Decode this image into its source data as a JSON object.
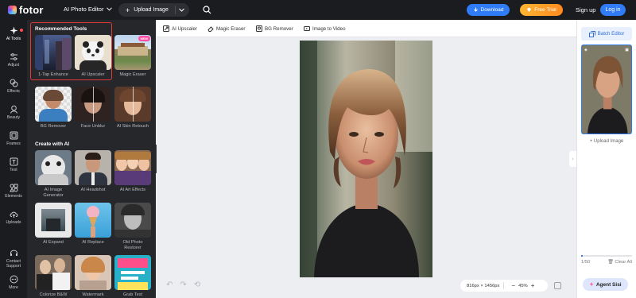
{
  "header": {
    "logo_text": "fotor",
    "app_menu_label": "AI Photo Editor",
    "upload_label": "Upload Image",
    "download_label": "Download",
    "free_trial_label": "Free Trial",
    "signup_label": "Sign up",
    "login_label": "Log in"
  },
  "rail": {
    "items": [
      {
        "label": "AI Tools",
        "icon": "sparkle-icon"
      },
      {
        "label": "Adjust",
        "icon": "sliders-icon"
      },
      {
        "label": "Effects",
        "icon": "effects-icon"
      },
      {
        "label": "Beauty",
        "icon": "beauty-icon"
      },
      {
        "label": "Frames",
        "icon": "frame-icon"
      },
      {
        "label": "Text",
        "icon": "text-icon"
      },
      {
        "label": "Elements",
        "icon": "elements-icon"
      },
      {
        "label": "Uploads",
        "icon": "cloud-upload-icon"
      },
      {
        "label": "Contact Support",
        "icon": "headset-icon"
      },
      {
        "label": "More",
        "icon": "more-icon"
      }
    ]
  },
  "panel": {
    "recommended_title": "Recommended Tools",
    "create_title": "Create with AI",
    "new_badge": "NEW",
    "recommended": [
      "1-Tap Enhance",
      "AI Upscaler",
      "Magic Eraser",
      "BG Remover",
      "Face Unblur",
      "AI Skin Retouch"
    ],
    "create": [
      "AI Image Generator",
      "AI Headshot",
      "AI Art Effects",
      "AI Expand",
      "AI Replace",
      "Old Photo Restorer",
      "Colorize B&W",
      "Watermark",
      "Grab Text"
    ]
  },
  "subtoolbar": {
    "items": [
      "AI Upscaler",
      "Magic Eraser",
      "BG Remover",
      "Image to Video"
    ]
  },
  "canvas": {
    "dimensions": "816px × 1456px",
    "zoom": "45%",
    "zoom_minus": "−",
    "zoom_plus": "+"
  },
  "right_panel": {
    "batch_label": "Batch Editor",
    "upload_label": "Upload Image",
    "count": "1/50",
    "clear_label": "Clear All",
    "agent_label": "Agent Sisi"
  },
  "colors": {
    "accent": "#2f7cf6",
    "trial": "#ff9f28",
    "highlight": "#e53935"
  }
}
